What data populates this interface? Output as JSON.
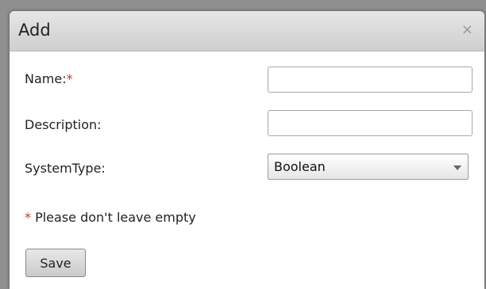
{
  "dialog": {
    "title": "Add",
    "close_glyph": "×",
    "close_icon": "close-icon"
  },
  "form": {
    "name_label": "Name:",
    "name_required_mark": "*",
    "name_value": "",
    "description_label": "Description:",
    "description_value": "",
    "system_type_label": "SystemType:",
    "system_type_selected": "Boolean",
    "hint_mark": "*",
    "hint_text": " Please don't leave empty",
    "save_label": "Save"
  },
  "colors": {
    "required": "#d32a2a",
    "titlebar": "#d9d9d9"
  }
}
